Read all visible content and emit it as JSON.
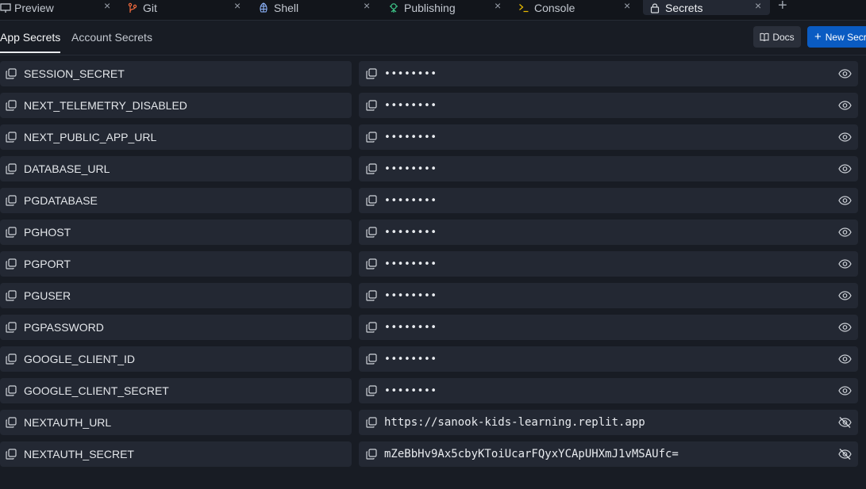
{
  "tabs": [
    {
      "label": "Preview",
      "icon": "monitor-icon",
      "active": false
    },
    {
      "label": "Git",
      "icon": "git-branch-icon",
      "active": false
    },
    {
      "label": "Shell",
      "icon": "shell-icon",
      "active": false
    },
    {
      "label": "Publishing",
      "icon": "publishing-icon",
      "active": false
    },
    {
      "label": "Console",
      "icon": "terminal-icon",
      "active": false
    },
    {
      "label": "Secrets",
      "icon": "lock-icon",
      "active": true
    }
  ],
  "subtabs": {
    "app_secrets": "App Secrets",
    "account_secrets": "Account Secrets"
  },
  "toolbar": {
    "docs_label": "Docs",
    "new_secret_label": "New Secret"
  },
  "secrets": [
    {
      "key": "SESSION_SECRET",
      "value": "••••••••",
      "revealed": false
    },
    {
      "key": "NEXT_TELEMETRY_DISABLED",
      "value": "••••••••",
      "revealed": false
    },
    {
      "key": "NEXT_PUBLIC_APP_URL",
      "value": "••••••••",
      "revealed": false
    },
    {
      "key": "DATABASE_URL",
      "value": "••••••••",
      "revealed": false
    },
    {
      "key": "PGDATABASE",
      "value": "••••••••",
      "revealed": false
    },
    {
      "key": "PGHOST",
      "value": "••••••••",
      "revealed": false
    },
    {
      "key": "PGPORT",
      "value": "••••••••",
      "revealed": false
    },
    {
      "key": "PGUSER",
      "value": "••••••••",
      "revealed": false
    },
    {
      "key": "PGPASSWORD",
      "value": "••••••••",
      "revealed": false
    },
    {
      "key": "GOOGLE_CLIENT_ID",
      "value": "••••••••",
      "revealed": false
    },
    {
      "key": "GOOGLE_CLIENT_SECRET",
      "value": "••••••••",
      "revealed": false
    },
    {
      "key": "NEXTAUTH_URL",
      "value": "https://sanook-kids-learning.replit.app",
      "revealed": true
    },
    {
      "key": "NEXTAUTH_SECRET",
      "value": "mZeBbHv9Ax5cbyKToiUcarFQyxYCApUHXmJ1vMSAUfc=",
      "revealed": true
    }
  ],
  "colors": {
    "background": "#181c24",
    "cell": "#232833",
    "accent": "#0a5bc2"
  }
}
